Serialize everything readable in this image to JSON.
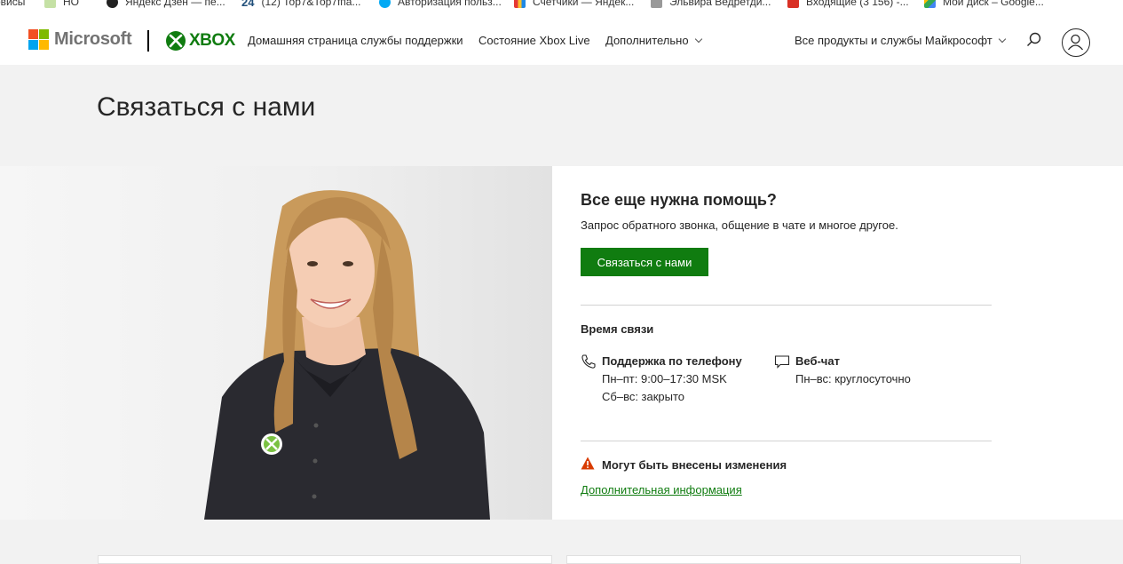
{
  "bookmarks": [
    {
      "label": "рвисы",
      "icon": "apps-icon",
      "color": "#555555"
    },
    {
      "label": "НО",
      "icon": "bookmark-icon",
      "color": "#9ccc65"
    },
    {
      "label": "Яндекс Дзен — пе...",
      "icon": "zen-icon",
      "color": "#222222"
    },
    {
      "label": "(12) Тор7&Тор7fпа...",
      "icon": "24-icon",
      "color": "#1f4e79"
    },
    {
      "label": "Авторизация польз...",
      "icon": "globe-icon",
      "color": "#03a9f4"
    },
    {
      "label": "Счетчики — Яндек...",
      "icon": "metrika-icon",
      "color": "#e53935"
    },
    {
      "label": "Эльвира Ведретди...",
      "icon": "doc-icon",
      "color": "#888888"
    },
    {
      "label": "Входящие (3 156) -...",
      "icon": "gmail-icon",
      "color": "#d93025"
    },
    {
      "label": "Мой диск – Google...",
      "icon": "drive-icon",
      "color": "#4285f4"
    }
  ],
  "header": {
    "brand": "Microsoft",
    "xbox": "XBOX",
    "nav_home": "Домашняя страница службы поддержки",
    "nav_status": "Состояние Xbox Live",
    "nav_more": "Дополнительно",
    "nav_products": "Все продукты и службы Майкрософт"
  },
  "page_title": "Связаться с нами",
  "help": {
    "title": "Все еще нужна помощь?",
    "subtitle": "Запрос обратного звонка, общение в чате и многое другое.",
    "button": "Связаться с нами",
    "hours_title": "Время связи",
    "phone": {
      "title": "Поддержка по телефону",
      "line1": "Пн–пт: 9:00–17:30 MSK",
      "line2": "Сб–вс: закрыто"
    },
    "chat": {
      "title": "Веб-чат",
      "line1": "Пн–вс: круглосуточно"
    },
    "warning": "Могут быть внесены изменения",
    "more_link": "Дополнительная информация"
  },
  "colors": {
    "accent": "#107c10",
    "warning": "#d83b01"
  }
}
